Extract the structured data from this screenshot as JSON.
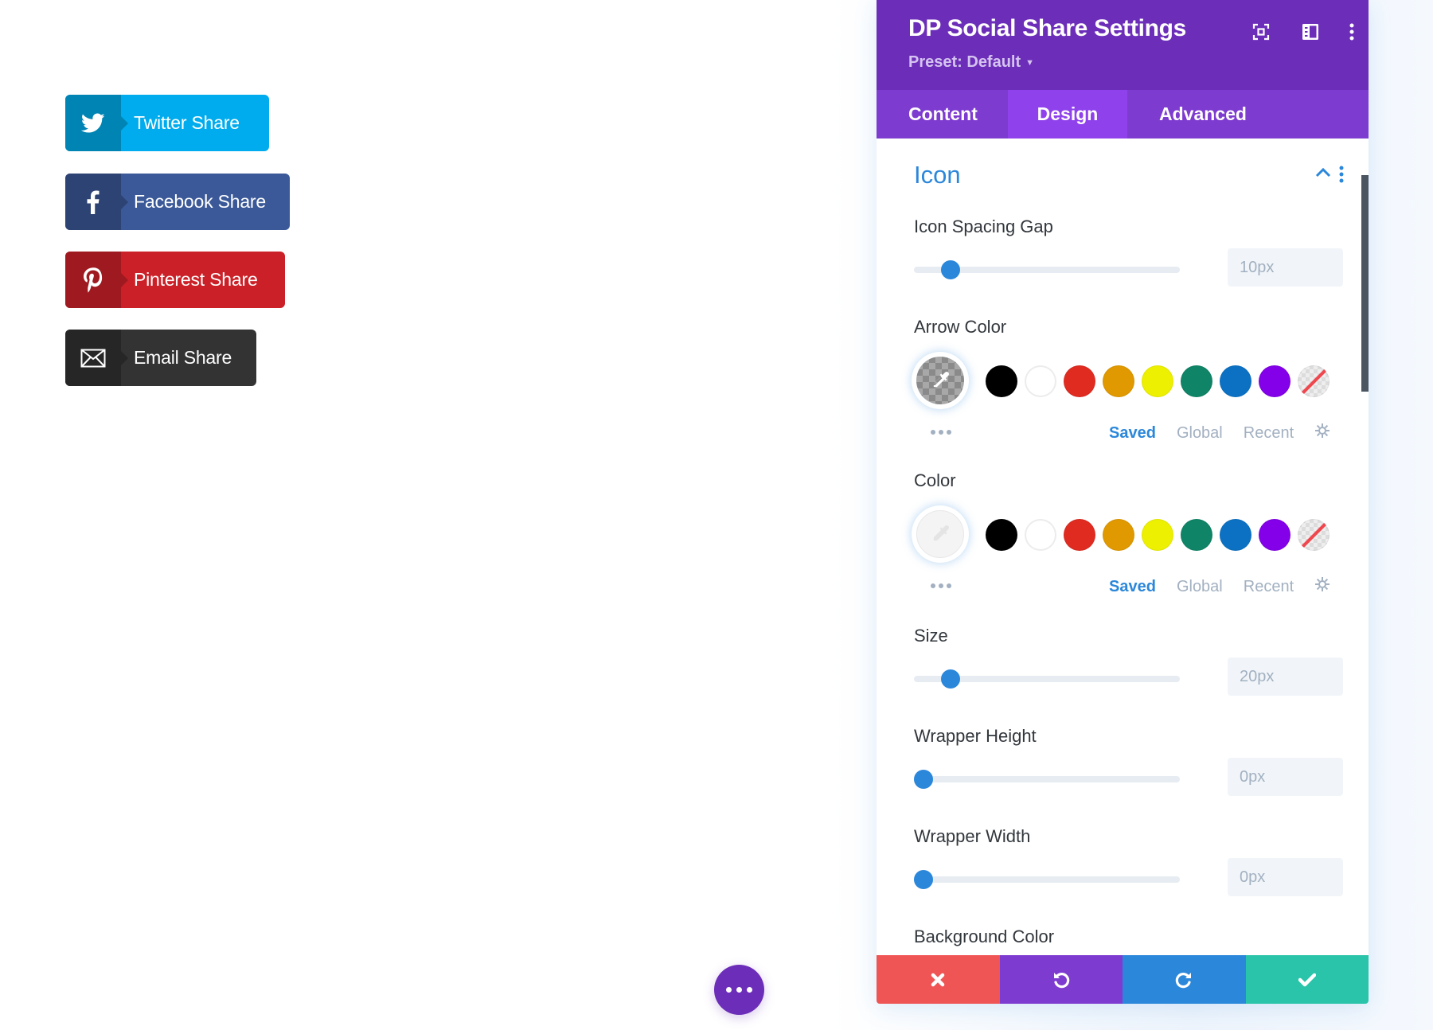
{
  "share_buttons": [
    {
      "network": "twitter",
      "label": "Twitter Share",
      "icon": "twitter-bird-icon",
      "color": "#00aced",
      "icon_bg": "#0084b4"
    },
    {
      "network": "facebook",
      "label": "Facebook Share",
      "icon": "facebook-f-icon",
      "color": "#3b5998",
      "icon_bg": "#2d4373"
    },
    {
      "network": "pinterest",
      "label": "Pinterest Share",
      "icon": "pinterest-p-icon",
      "color": "#cb2027",
      "icon_bg": "#9f1a20"
    },
    {
      "network": "email",
      "label": "Email Share",
      "icon": "envelope-icon",
      "color": "#333333",
      "icon_bg": "#262626"
    }
  ],
  "floating_menu": {
    "icon": "ellipsis-icon",
    "color": "#6c2eb9"
  },
  "panel": {
    "title": "DP Social Share Settings",
    "preset": "Preset: Default",
    "header_icons": [
      "focus-mode-icon",
      "split-view-icon",
      "more-vertical-icon"
    ],
    "tabs": [
      {
        "label": "Content",
        "active": false
      },
      {
        "label": "Design",
        "active": true
      },
      {
        "label": "Advanced",
        "active": false
      }
    ],
    "section": {
      "title": "Icon",
      "expanded": true
    },
    "fields": {
      "icon_spacing_gap": {
        "label": "Icon Spacing Gap",
        "value": "10px",
        "slider_fraction": 0.11
      },
      "arrow_color": {
        "label": "Arrow Color",
        "current": "transparent"
      },
      "color": {
        "label": "Color",
        "current": "none"
      },
      "size": {
        "label": "Size",
        "value": "20px",
        "slider_fraction": 0.11
      },
      "wrapper_height": {
        "label": "Wrapper Height",
        "value": "0px",
        "slider_fraction": 0.0
      },
      "wrapper_width": {
        "label": "Wrapper Width",
        "value": "0px",
        "slider_fraction": 0.0
      },
      "background_color": {
        "label": "Background Color"
      }
    },
    "swatches": [
      "#000000",
      "#ffffff",
      "#e02b20",
      "#e09900",
      "#edf000",
      "#0f8467",
      "#0c71c3",
      "#8300e9",
      "none"
    ],
    "palette_tabs": [
      {
        "label": "Saved",
        "active": true
      },
      {
        "label": "Global",
        "active": false
      },
      {
        "label": "Recent",
        "active": false
      }
    ],
    "footer": [
      {
        "action": "cancel",
        "icon": "close-icon",
        "color": "#ef5555"
      },
      {
        "action": "undo",
        "icon": "undo-icon",
        "color": "#7e3bd0"
      },
      {
        "action": "redo",
        "icon": "redo-icon",
        "color": "#2b87da"
      },
      {
        "action": "save",
        "icon": "check-icon",
        "color": "#29c4a9"
      }
    ]
  }
}
